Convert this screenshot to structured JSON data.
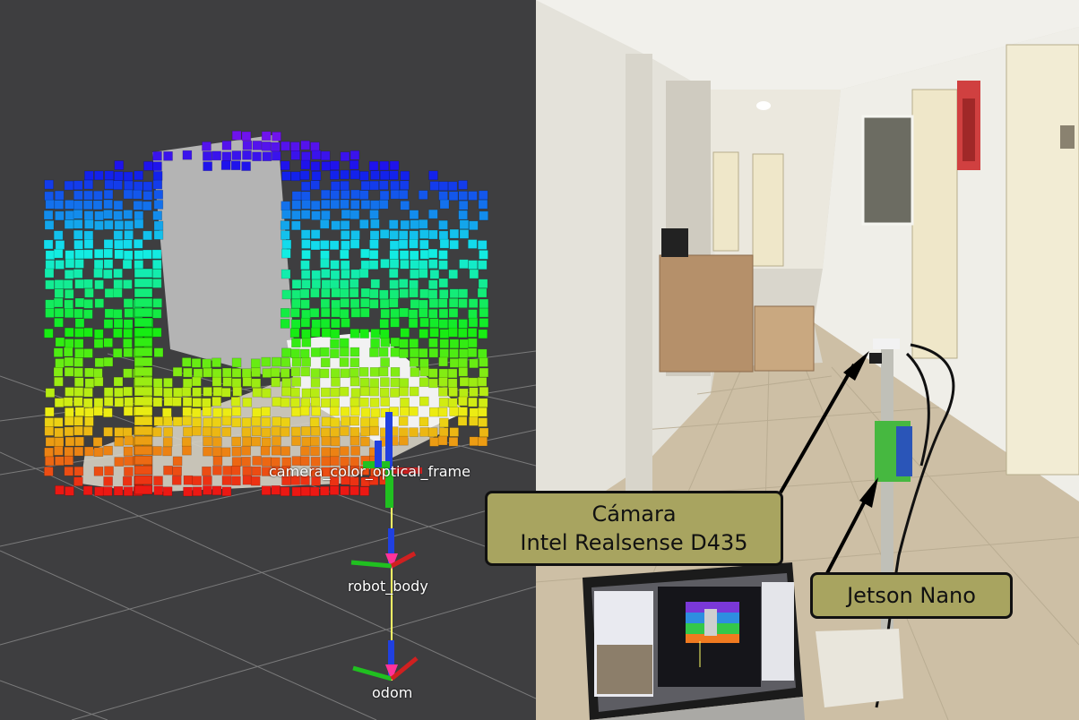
{
  "rviz_view": {
    "tf_frames": {
      "camera_cluster": "camera_color_optical_frame",
      "robot_body": "robot_body",
      "odom": "odom"
    },
    "colors": {
      "background": "#3e3e40",
      "grid": "#8a8a8a",
      "x_axis": "#d02020",
      "y_axis": "#20c020",
      "z_axis": "#2040e0",
      "link": "#ffff66"
    }
  },
  "photo_view": {
    "callouts": {
      "camera_line1": "Cámara",
      "camera_line2": "Intel Realsense D435",
      "jetson": "Jetson Nano"
    },
    "colors": {
      "callout_fill": "#a8a460",
      "callout_border": "#111111",
      "wall": "#e8e6de",
      "floor": "#cdbfa5"
    }
  }
}
